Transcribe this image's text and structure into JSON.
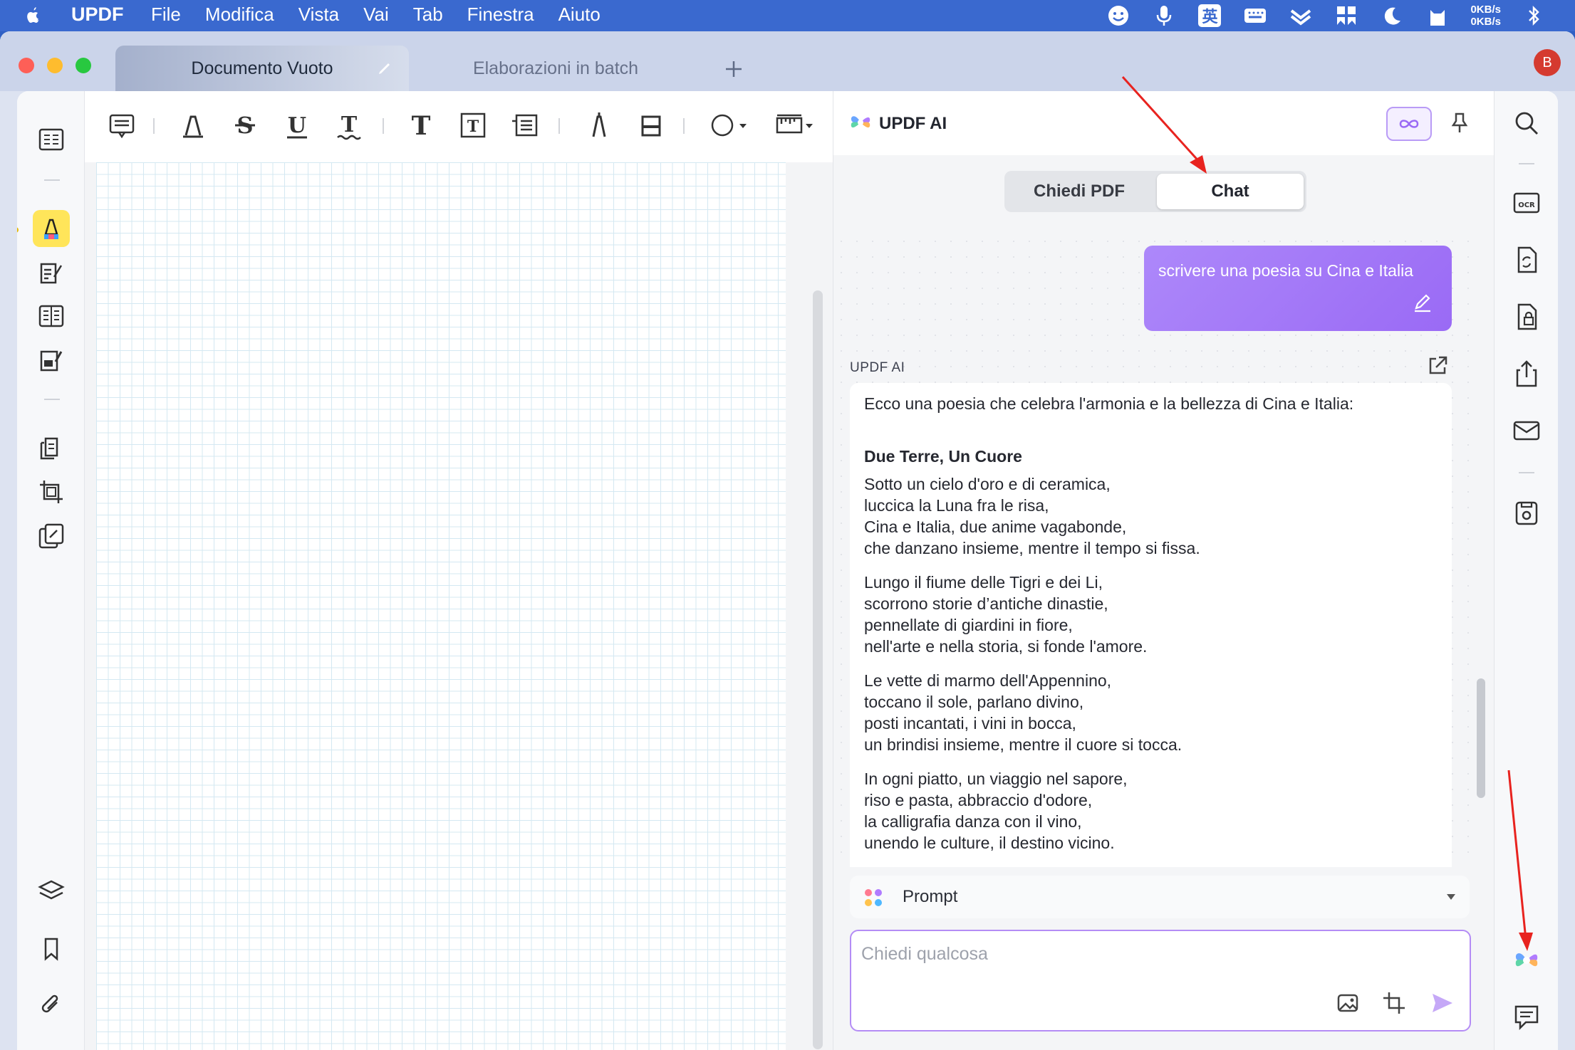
{
  "menubar": {
    "app": "UPDF",
    "items": [
      "File",
      "Modifica",
      "Vista",
      "Vai",
      "Tab",
      "Finestra",
      "Aiuto"
    ],
    "net_up": "0KB/s",
    "net_down": "0KB/s",
    "ime_label": "英"
  },
  "tabs": {
    "active": "Documento Vuoto",
    "inactive": "Elaborazioni in batch"
  },
  "avatar_letter": "B",
  "ai": {
    "title": "UPDF AI",
    "seg_pdf": "Chiedi PDF",
    "seg_chat": "Chat",
    "user_message": "scrivere una poesia su Cina e Italia",
    "label": "UPDF AI",
    "intro": "Ecco una poesia che celebra l'armonia e la bellezza di Cina e Italia:",
    "poem_title": "Due Terre, Un Cuore",
    "stanzas": [
      [
        "Sotto un cielo d'oro e di ceramica,",
        "luccica la Luna fra le risa,",
        "Cina e Italia, due anime vagabonde,",
        "che danzano insieme, mentre il tempo si fissa."
      ],
      [
        "Lungo il fiume delle Tigri e dei Li,",
        "scorrono storie d’antiche dinastie,",
        "pennellate di giardini in fiore,",
        "nell'arte e nella storia, si fonde l'amore."
      ],
      [
        "Le vette di marmo dell'Appennino,",
        "toccano il sole, parlano divino,",
        "posti incantati, i vini in bocca,",
        "un brindisi insieme, mentre il cuore si tocca."
      ],
      [
        "In ogni piatto, un viaggio nel sapore,",
        "riso e pasta, abbraccio d'odore,",
        "la calligrafia danza con il vino,",
        "unendo le culture, il destino vicino."
      ]
    ],
    "prompt_label": "Prompt",
    "input_placeholder": "Chiedi qualcosa"
  },
  "colors": {
    "accent": "#9a6af5",
    "menubar": "#3a69cf",
    "highlight_tool": "#ffe55a",
    "annotation_arrow": "#e8231f"
  }
}
